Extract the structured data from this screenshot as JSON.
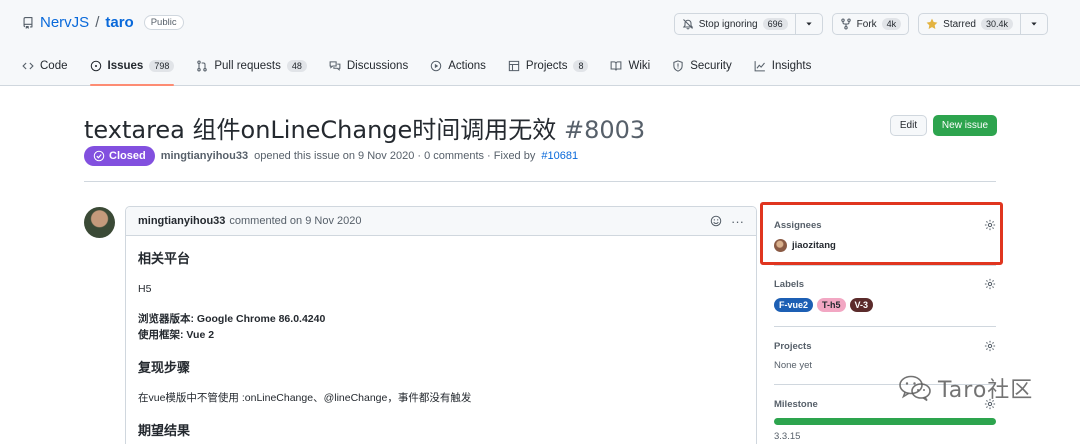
{
  "repo": {
    "owner": "NervJS",
    "separator": "/",
    "name": "taro",
    "visibility": "Public"
  },
  "header_buttons": {
    "watch": {
      "label": "Stop ignoring",
      "count": "696",
      "icon": "bell-slash-icon"
    },
    "fork": {
      "label": "Fork",
      "count": "4k",
      "icon": "fork-icon"
    },
    "star": {
      "label": "Starred",
      "count": "30.4k",
      "icon": "star-filled-icon",
      "color": "#e3b341"
    }
  },
  "tabs": [
    {
      "label": "Code",
      "icon": "code-icon"
    },
    {
      "label": "Issues",
      "count": "798",
      "icon": "issue-opened-icon",
      "active": true
    },
    {
      "label": "Pull requests",
      "count": "48",
      "icon": "pull-request-icon"
    },
    {
      "label": "Discussions",
      "icon": "comment-discussion-icon"
    },
    {
      "label": "Actions",
      "icon": "play-icon"
    },
    {
      "label": "Projects",
      "count": "8",
      "icon": "table-icon"
    },
    {
      "label": "Wiki",
      "icon": "book-icon"
    },
    {
      "label": "Security",
      "icon": "shield-icon"
    },
    {
      "label": "Insights",
      "icon": "graph-icon"
    }
  ],
  "issue": {
    "title": "textarea 组件onLineChange时间调用无效",
    "number": "#8003",
    "edit_label": "Edit",
    "new_label": "New issue",
    "state": "Closed",
    "state_color": "#8250df",
    "author": "mingtianyihou33",
    "opened_text": "opened this issue on 9 Nov 2020 · 0 comments · Fixed by",
    "fixed_by": "#10681"
  },
  "comment": {
    "author": "mingtianyihou33",
    "action": "commented on 9 Nov 2020",
    "more": "···",
    "sections": {
      "platform_heading": "相关平台",
      "platform_value": "H5",
      "browser_label": "浏览器版本:",
      "browser_value": "Google Chrome 86.0.4240",
      "framework_label": "使用框架:",
      "framework_value": "Vue 2",
      "steps_heading": "复现步骤",
      "steps_text": "在vue模版中不管使用 :onLineChange、@lineChange，事件都没有触发",
      "expected_heading": "期望结果"
    }
  },
  "sidebar": {
    "assignees": {
      "title": "Assignees",
      "user": "jiaozitang"
    },
    "labels": {
      "title": "Labels",
      "items": [
        {
          "name": "F-vue2",
          "bg": "#1d5fb4",
          "fg": "#ffffff"
        },
        {
          "name": "T-h5",
          "bg": "#f2a7c3",
          "fg": "#24292f"
        },
        {
          "name": "V-3",
          "bg": "#5b2b2b",
          "fg": "#ffffff"
        }
      ]
    },
    "projects": {
      "title": "Projects",
      "value": "None yet"
    },
    "milestone": {
      "title": "Milestone",
      "value": "3.3.15",
      "progress": 1.0
    }
  },
  "watermark": {
    "text": "Taro社区",
    "icon": "wechat-logo-icon"
  },
  "colors": {
    "accent_link": "#0969da",
    "highlight_box": "#e0351f",
    "new_button": "#2da44e"
  }
}
